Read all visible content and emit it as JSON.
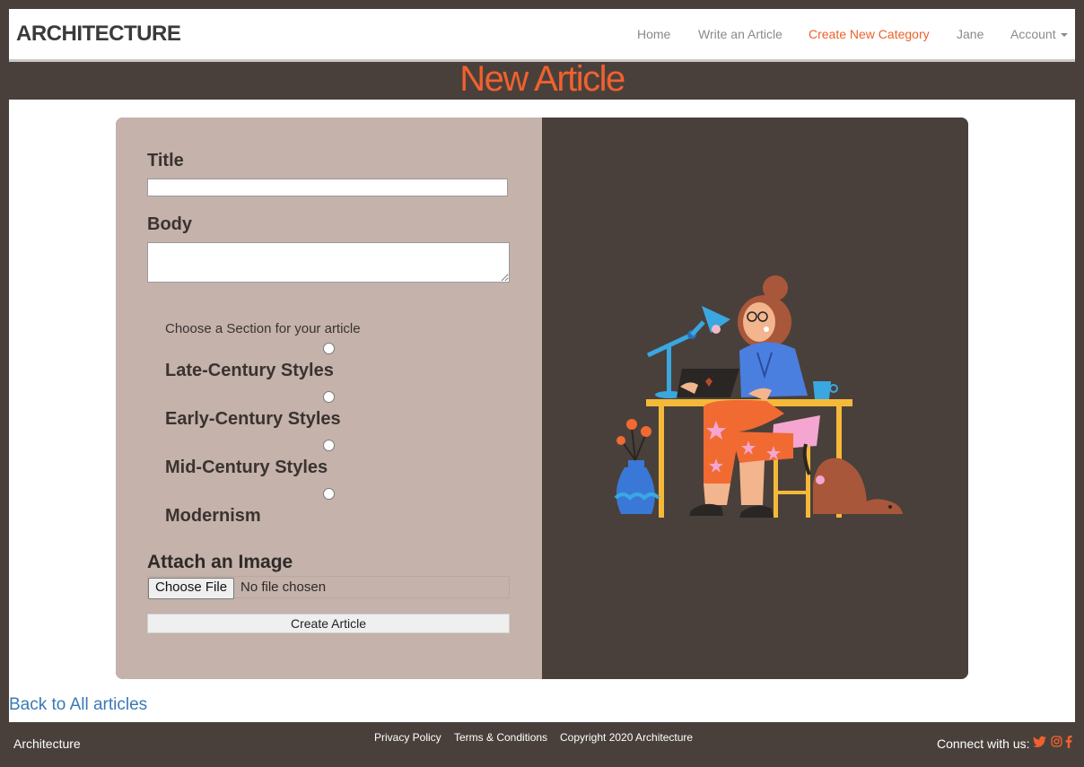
{
  "nav": {
    "brand": "ARCHITECTURE",
    "items": [
      {
        "label": "Home",
        "active": false
      },
      {
        "label": "Write an Article",
        "active": false
      },
      {
        "label": "Create New Category",
        "active": true
      },
      {
        "label": "Jane",
        "active": false
      },
      {
        "label": "Account",
        "active": false,
        "dropdown": true
      }
    ]
  },
  "page": {
    "title": "New Article"
  },
  "form": {
    "title_label": "Title",
    "title_value": "",
    "body_label": "Body",
    "body_value": "",
    "section_prompt": "Choose a Section for your article",
    "sections": [
      {
        "label": "Late-Century Styles",
        "selected": false
      },
      {
        "label": "Early-Century Styles",
        "selected": false
      },
      {
        "label": "Mid-Century Styles",
        "selected": false
      },
      {
        "label": "Modernism",
        "selected": false
      }
    ],
    "attach_label": "Attach an Image",
    "file_button": "Choose File",
    "file_status": "No file chosen",
    "submit_label": "Create Article"
  },
  "illustration": {
    "icon": "woman-at-desk-illustration"
  },
  "links": {
    "back": "Back to All articles"
  },
  "footer": {
    "brand": "Architecture",
    "links": [
      "Privacy Policy",
      "Terms & Conditions",
      "Copyright 2020 Architecture"
    ],
    "connect_label": "Connect with us:",
    "social_icons": [
      "twitter-icon",
      "instagram-icon",
      "facebook-icon"
    ]
  },
  "colors": {
    "accent": "#f0612e",
    "frame": "#4a403b",
    "form_panel": "#c4b2ab",
    "link": "#3b79b4"
  }
}
